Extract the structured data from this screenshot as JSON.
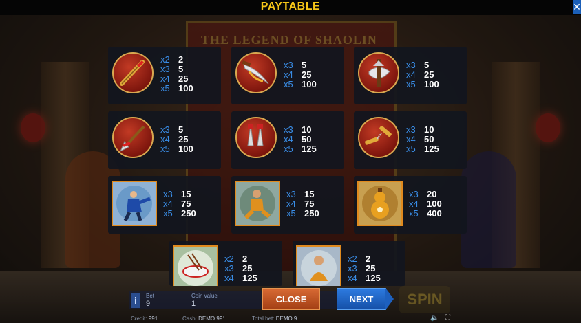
{
  "header": {
    "title": "PAYTABLE",
    "close_glyph": "✕"
  },
  "background": {
    "logo_text": "THE LEGEND OF SHAOLIN"
  },
  "symbols": [
    {
      "icon": "staff-icon",
      "pays": [
        {
          "m": "x2",
          "v": "2"
        },
        {
          "m": "x3",
          "v": "5"
        },
        {
          "m": "x4",
          "v": "25"
        },
        {
          "m": "x5",
          "v": "100"
        }
      ]
    },
    {
      "icon": "sword-icon",
      "pays": [
        {
          "m": "x3",
          "v": "5"
        },
        {
          "m": "x4",
          "v": "25"
        },
        {
          "m": "x5",
          "v": "100"
        }
      ]
    },
    {
      "icon": "axe-icon",
      "pays": [
        {
          "m": "x3",
          "v": "5"
        },
        {
          "m": "x4",
          "v": "25"
        },
        {
          "m": "x5",
          "v": "100"
        }
      ]
    },
    {
      "icon": "spear-icon",
      "pays": [
        {
          "m": "x3",
          "v": "5"
        },
        {
          "m": "x4",
          "v": "25"
        },
        {
          "m": "x5",
          "v": "100"
        }
      ]
    },
    {
      "icon": "twin-daggers-icon",
      "pays": [
        {
          "m": "x3",
          "v": "10"
        },
        {
          "m": "x4",
          "v": "50"
        },
        {
          "m": "x5",
          "v": "125"
        }
      ]
    },
    {
      "icon": "nunchaku-icon",
      "pays": [
        {
          "m": "x3",
          "v": "10"
        },
        {
          "m": "x4",
          "v": "50"
        },
        {
          "m": "x5",
          "v": "125"
        }
      ]
    },
    {
      "icon": "blue-fighter-icon",
      "pays": [
        {
          "m": "x3",
          "v": "15"
        },
        {
          "m": "x4",
          "v": "75"
        },
        {
          "m": "x5",
          "v": "250"
        }
      ]
    },
    {
      "icon": "monk-kicking-icon",
      "pays": [
        {
          "m": "x3",
          "v": "15"
        },
        {
          "m": "x4",
          "v": "75"
        },
        {
          "m": "x5",
          "v": "250"
        }
      ]
    },
    {
      "icon": "gourd-icon",
      "pays": [
        {
          "m": "x3",
          "v": "20"
        },
        {
          "m": "x4",
          "v": "100"
        },
        {
          "m": "x5",
          "v": "400"
        }
      ]
    },
    {
      "icon": "rice-bowl-icon",
      "pays": [
        {
          "m": "x2",
          "v": "2"
        },
        {
          "m": "x3",
          "v": "25"
        },
        {
          "m": "x4",
          "v": "125"
        }
      ]
    },
    {
      "icon": "meditating-monk-icon",
      "pays": [
        {
          "m": "x2",
          "v": "2"
        },
        {
          "m": "x3",
          "v": "25"
        },
        {
          "m": "x4",
          "v": "125"
        }
      ]
    }
  ],
  "controls": {
    "info_label": "i",
    "bet_label": "Bet",
    "bet_value": "9",
    "coin_label": "Coin value",
    "coin_value": "1",
    "close_label": "CLOSE",
    "next_label": "NEXT",
    "spin_label": "SPIN"
  },
  "status": {
    "credit_label": "Credit:",
    "credit_value": "991",
    "cash_label": "Cash:",
    "cash_value": "DEMO 991",
    "total_bet_label": "Total bet:",
    "total_bet_value": "DEMO 9"
  }
}
